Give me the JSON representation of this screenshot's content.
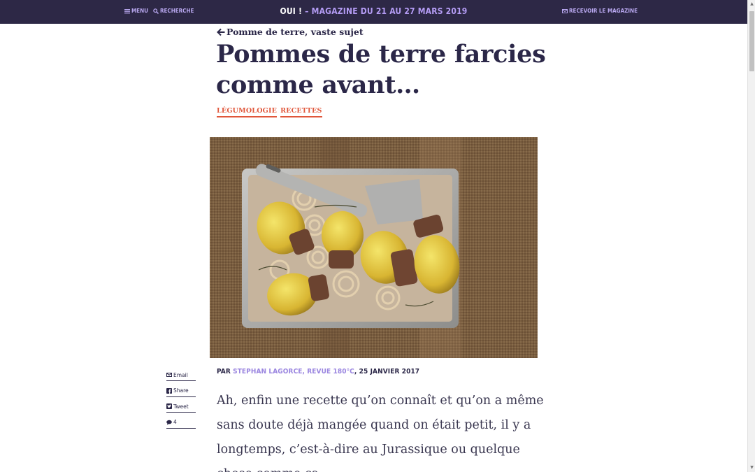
{
  "header": {
    "menu_label": "MENU",
    "search_label": "RECHERCHE",
    "brand": "OUI !",
    "issue": "– MAGAZINE DU 21 AU 27 MARS 2019",
    "subscribe_label": "RECEVOIR LE MAGAZINE"
  },
  "article": {
    "back_label": "Pomme de terre, vaste sujet",
    "title": "Pommes de terre farcies comme avant…",
    "tags": [
      "LÉGUMOLOGIE",
      "RECETTES"
    ],
    "byline_prefix": "PAR",
    "author": "STEPHAN LAGORCE, REVUE 180°C",
    "date": ", 25 JANVIER 2017",
    "body": "Ah, enfin une recette qu’on connaît et qu’on a même sans doute déjà mangée quand on était petit, il y a longtemps, c’est-à-dire au Jurassique ou quelque chose comme ça."
  },
  "share": {
    "email": "Email",
    "facebook": "Share",
    "twitter": "Tweet",
    "comments": "4"
  },
  "colors": {
    "header_bg": "#2d2846",
    "accent": "#e0563a",
    "link": "#9a85e0"
  }
}
